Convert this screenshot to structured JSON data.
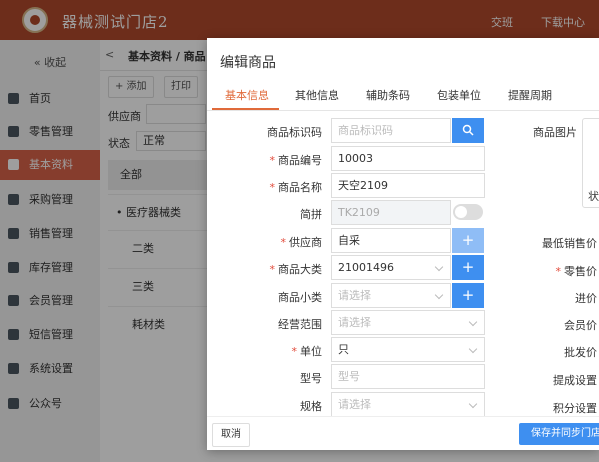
{
  "app": {
    "title": "器械测试门店2",
    "links": [
      "交班",
      "下载中心"
    ]
  },
  "sidebar": {
    "collapse": "« 收起",
    "items": [
      {
        "label": "首页",
        "icon": "home-icon"
      },
      {
        "label": "零售管理",
        "icon": "retail-icon"
      },
      {
        "label": "基本资料",
        "icon": "document-icon",
        "active": true
      },
      {
        "label": "采购管理",
        "icon": "purchase-icon"
      },
      {
        "label": "销售管理",
        "icon": "sales-icon"
      },
      {
        "label": "库存管理",
        "icon": "inventory-icon"
      },
      {
        "label": "会员管理",
        "icon": "member-icon"
      },
      {
        "label": "短信管理",
        "icon": "sms-icon"
      },
      {
        "label": "系统设置",
        "icon": "settings-icon"
      },
      {
        "label": "公众号",
        "icon": "grid-icon"
      }
    ]
  },
  "main": {
    "breadcrumb": {
      "back": "<",
      "title": "基本资料  /  商品"
    },
    "toolbar": {
      "add": "+ 添加",
      "print": "打印"
    },
    "filters": {
      "supplier_label": "供应商",
      "status_label": "状态",
      "status_value": "正常"
    },
    "categories": {
      "header": "全部",
      "items": [
        "医疗器械类",
        "二类",
        "三类",
        "耗材类"
      ]
    }
  },
  "modal": {
    "title": "编辑商品",
    "tabs": [
      "基本信息",
      "其他信息",
      "辅助条码",
      "包装单位",
      "提醒周期"
    ],
    "fields": {
      "barcode": {
        "label": "商品标识码",
        "placeholder": "商品标识码"
      },
      "code": {
        "label": "商品编号",
        "value": "10003"
      },
      "name": {
        "label": "商品名称",
        "value": "天空2109"
      },
      "pinyin": {
        "label": "简拼",
        "value": "TK2109"
      },
      "supplier": {
        "label": "供应商",
        "value": "自采"
      },
      "major_category": {
        "label": "商品大类",
        "value": "21001496"
      },
      "minor_category": {
        "label": "商品小类",
        "placeholder": "请选择"
      },
      "scope": {
        "label": "经营范围",
        "placeholder": "请选择"
      },
      "unit": {
        "label": "单位",
        "value": "只"
      },
      "model": {
        "label": "型号",
        "placeholder": "型号"
      },
      "spec": {
        "label": "规格",
        "placeholder": "请选择"
      }
    },
    "right_labels": {
      "image": "商品图片",
      "shape": "状",
      "min_price": "最低销售价",
      "retail_price": "零售价",
      "purchase_price": "进价",
      "member_price": "会员价",
      "wholesale_price": "批发价",
      "commission": "提成设置",
      "points": "积分设置"
    },
    "buttons": {
      "cancel": "取消",
      "save": "保存并同步门店配"
    }
  }
}
